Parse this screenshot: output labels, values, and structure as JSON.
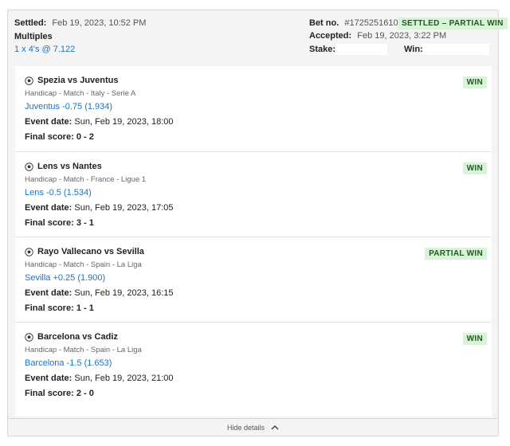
{
  "header": {
    "settled_label": "Settled:",
    "settled_value": "Feb 19, 2023, 10:52 PM",
    "bet_type": "Multiples",
    "bet_detail": "1 x 4's @ 7.122",
    "bet_no_label": "Bet no.",
    "bet_no_value": "#1725251610",
    "status_badge": "SETTLED – PARTIAL WIN",
    "accepted_label": "Accepted:",
    "accepted_value": "Feb 19, 2023, 3:22 PM",
    "stake_label": "Stake:",
    "win_label": "Win:"
  },
  "selections": [
    {
      "match": "Spezia vs Juventus",
      "meta": "Handicap - Match - Italy - Serie A",
      "pick": "Juventus -0.75 (1.934)",
      "event_label": "Event date:",
      "event_value": "Sun, Feb 19, 2023, 18:00",
      "score_label": "Final score:",
      "score_value": "0 - 2",
      "result": "WIN"
    },
    {
      "match": "Lens vs Nantes",
      "meta": "Handicap - Match - France - Ligue 1",
      "pick": "Lens -0.5 (1.534)",
      "event_label": "Event date:",
      "event_value": "Sun, Feb 19, 2023, 17:05",
      "score_label": "Final score:",
      "score_value": "3 - 1",
      "result": "WIN"
    },
    {
      "match": "Rayo Vallecano vs Sevilla",
      "meta": "Handicap - Match - Spain - La Liga",
      "pick": "Sevilla +0.25 (1.900)",
      "event_label": "Event date:",
      "event_value": "Sun, Feb 19, 2023, 16:15",
      "score_label": "Final score:",
      "score_value": "1 - 1",
      "result": "PARTIAL WIN"
    },
    {
      "match": "Barcelona vs Cadiz",
      "meta": "Handicap - Match - Spain - La Liga",
      "pick": "Barcelona -1.5 (1.653)",
      "event_label": "Event date:",
      "event_value": "Sun, Feb 19, 2023, 21:00",
      "score_label": "Final score:",
      "score_value": "2 - 0",
      "result": "WIN"
    }
  ],
  "footer": {
    "toggle_label": "Hide details"
  },
  "icons": {
    "sport": "soccer-ball-icon",
    "toggle": "chevron-up-icon"
  },
  "colors": {
    "link": "#1a73c8",
    "win_badge_bg": "#d8f3d8",
    "win_badge_text": "#1e5b1e"
  }
}
